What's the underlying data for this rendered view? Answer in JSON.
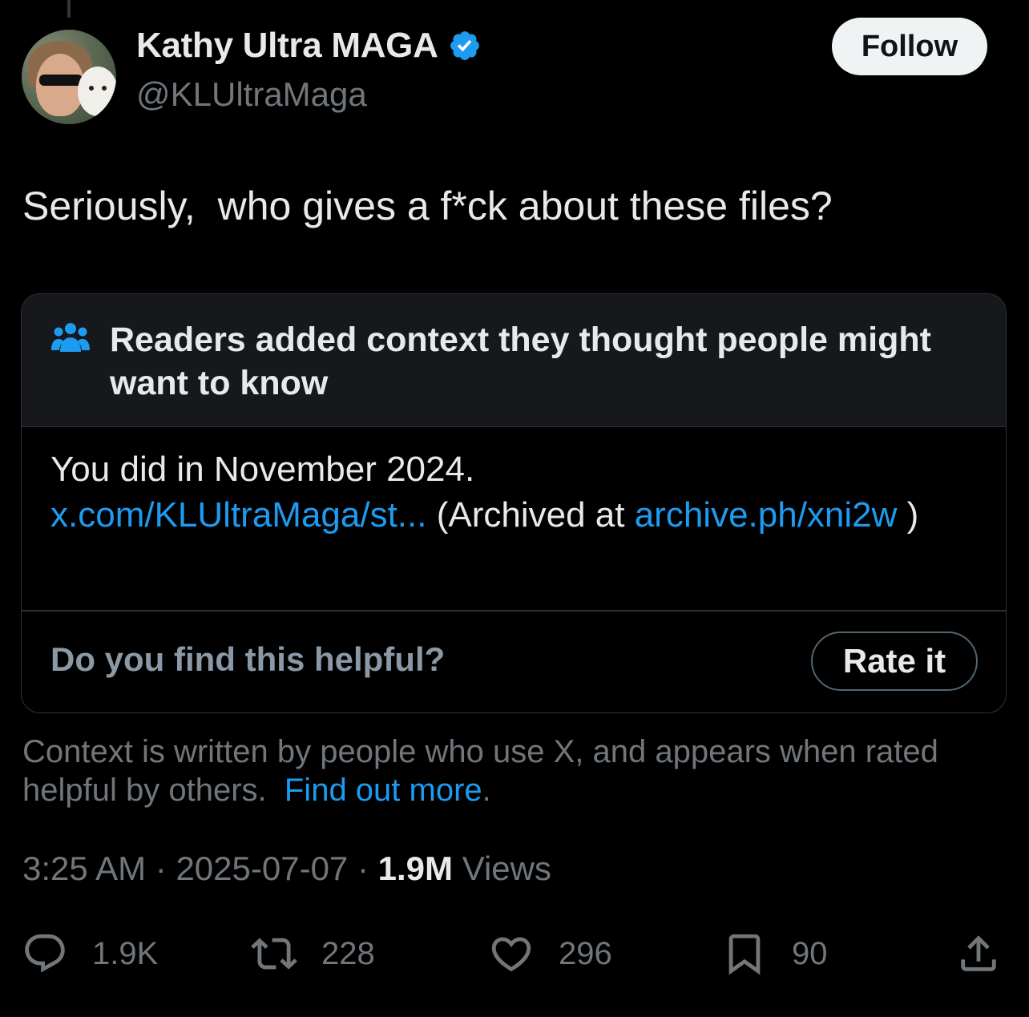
{
  "author": {
    "display_name": "Kathy Ultra MAGA",
    "handle": "@KLUltraMaga",
    "verified": true,
    "verified_color": "#1d9bf0"
  },
  "follow_label": "Follow",
  "tweet": {
    "text": "Seriously,  who gives a f*ck about these files?"
  },
  "community_note": {
    "icon": "people-icon",
    "title": "Readers added context they thought people might want to know",
    "body_text_1": "You did in November 2024.",
    "link_1": "x.com/KLUltraMaga/st...",
    "body_text_2": " (Archived at ",
    "link_2": "archive.ph/xni2w",
    "body_text_3": " )",
    "helpful_question": "Do you find this helpful?",
    "rate_label": "Rate it"
  },
  "context_info": {
    "text": "Context is written by people who use X, and appears when rated helpful by others.",
    "link": "Find out more",
    "suffix": "."
  },
  "meta": {
    "time": "3:25 AM",
    "separator": "·",
    "date": "2025-07-07",
    "views_count": "1.9M",
    "views_label": "Views"
  },
  "actions": {
    "replies": "1.9K",
    "reposts": "228",
    "likes": "296",
    "bookmarks": "90"
  },
  "colors": {
    "background": "#000000",
    "text": "#e7e9ea",
    "secondary": "#71767b",
    "link": "#1d9bf0",
    "border": "#2f3336"
  }
}
